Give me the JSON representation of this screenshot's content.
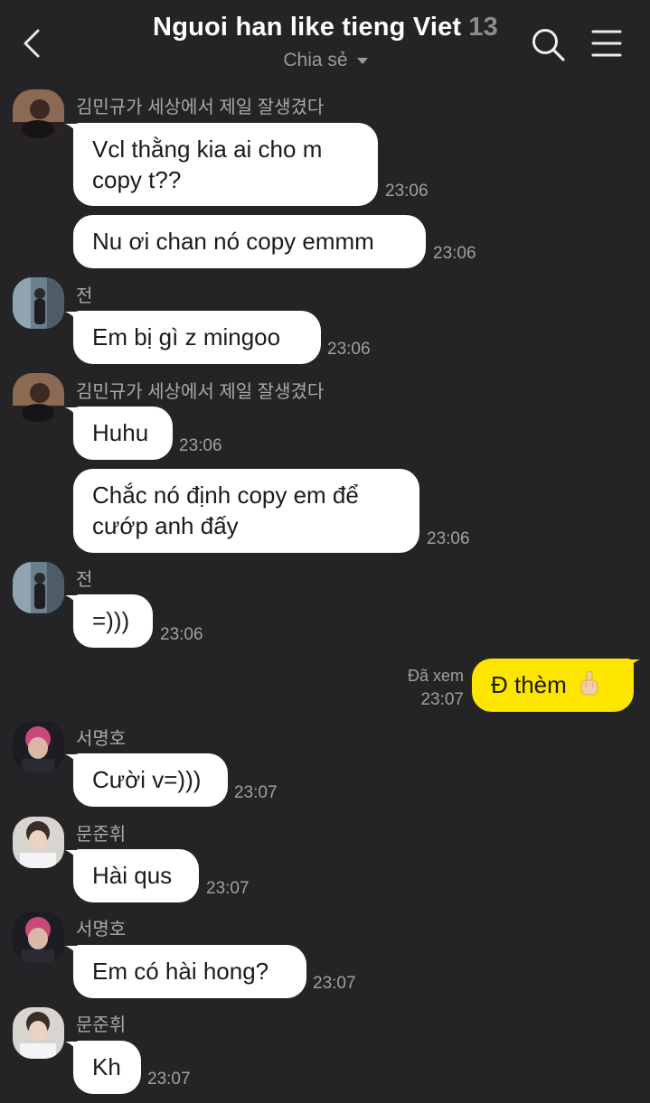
{
  "header": {
    "title": "Nguoi han like tieng Viet",
    "member_count": "13",
    "subtitle": "Chia sẻ"
  },
  "messages": {
    "m1": {
      "sender": "김민규가 세상에서 제일 잘생겼다",
      "text": "Vcl thằng kia ai cho m",
      "text2": "copy t??",
      "time": "23:06"
    },
    "m2": {
      "text": "Nu ơi chan nó copy emmm",
      "time": "23:06"
    },
    "m3": {
      "sender": "전",
      "text": "Em bị gì z mingoo",
      "time": "23:06"
    },
    "m4": {
      "sender": "김민규가 세상에서 제일 잘생겼다",
      "text": "Huhu",
      "time": "23:06"
    },
    "m5": {
      "text": "Chắc nó định copy em để",
      "text2": "cướp anh đấy",
      "time": "23:06"
    },
    "m6": {
      "sender": "전",
      "text": "=)))",
      "time": "23:06"
    },
    "m7": {
      "text": "Đ thèm",
      "status": "Đã xem",
      "time": "23:07"
    },
    "m8": {
      "sender": "서명호",
      "text": "Cười v=)))",
      "time": "23:07"
    },
    "m9": {
      "sender": "문준휘",
      "text": "Hài qus",
      "time": "23:07"
    },
    "m10": {
      "sender": "서명호",
      "text": "Em có hài hong?",
      "time": "23:07"
    },
    "m11": {
      "sender": "문준휘",
      "text": "Kh",
      "time": "23:07"
    }
  },
  "icons": {
    "back": "chevron-left-icon",
    "search": "search-icon",
    "menu": "menu-icon",
    "emoji": "middle-finger-emoji"
  },
  "colors": {
    "background": "#242427",
    "bubble_other": "#ffffff",
    "bubble_me": "#fee500",
    "text_muted": "#a0a0a3"
  }
}
